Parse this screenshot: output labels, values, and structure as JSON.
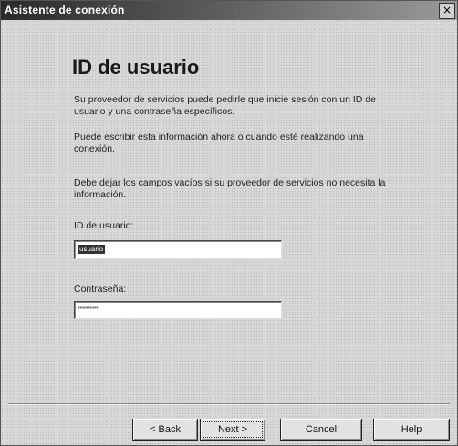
{
  "window": {
    "title": "Asistente de conexión",
    "close_glyph": "×"
  },
  "page": {
    "heading": "ID de usuario",
    "paragraph1": "Su proveedor de servicios puede pedirle que inicie sesión con un ID de usuario y una contraseña específicos.",
    "paragraph2": "Puede escribir esta información ahora o cuando esté realizando una conexión.",
    "paragraph3": "Debe dejar los campos vacíos si su proveedor de servicios no necesita la información."
  },
  "fields": {
    "user_id_label": "ID de usuario:",
    "user_id_value": "usuario",
    "password_label": "Contraseña:",
    "password_value": "**********"
  },
  "buttons": {
    "back": "< Back",
    "next": "Next >",
    "cancel": "Cancel",
    "help": "Help"
  },
  "icons": {
    "close": "close-icon"
  }
}
